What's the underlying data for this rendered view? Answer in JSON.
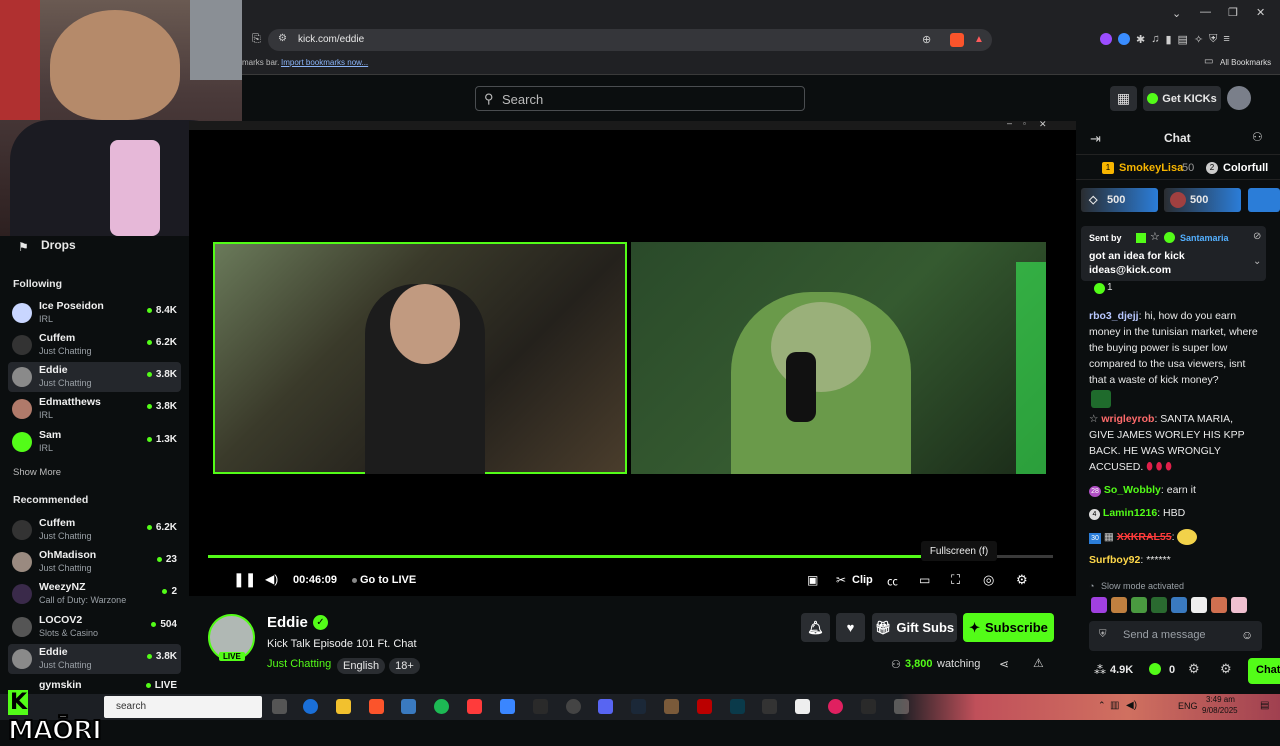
{
  "browser": {
    "url": "kick.com/eddie",
    "bookmarks_text": "marks bar.",
    "import_bookmarks": "Import bookmarks now...",
    "all_bookmarks": "All Bookmarks"
  },
  "header": {
    "search_placeholder": "Search",
    "get_kicks_label": "Get KICKs"
  },
  "sidebar": {
    "drops_label": "Drops",
    "following_heading": "Following",
    "following": [
      {
        "name": "Ice Poseidon",
        "category": "IRL",
        "viewers": "8.4K"
      },
      {
        "name": "Cuffem",
        "category": "Just Chatting",
        "viewers": "6.2K"
      },
      {
        "name": "Eddie",
        "category": "Just Chatting",
        "viewers": "3.8K"
      },
      {
        "name": "Edmatthews",
        "category": "IRL",
        "viewers": "3.8K"
      },
      {
        "name": "Sam",
        "category": "IRL",
        "viewers": "1.3K"
      }
    ],
    "show_more": "Show More",
    "recommended_heading": "Recommended",
    "recommended": [
      {
        "name": "Cuffem",
        "category": "Just Chatting",
        "viewers": "6.2K"
      },
      {
        "name": "OhMadison",
        "category": "Just Chatting",
        "viewers": "23"
      },
      {
        "name": "WeezyNZ",
        "category": "Call of Duty: Warzone",
        "viewers": "2"
      },
      {
        "name": "LOCOV2",
        "category": "Slots & Casino",
        "viewers": "504"
      },
      {
        "name": "Eddie",
        "category": "Just Chatting",
        "viewers": "3.8K"
      },
      {
        "name": "gymskin",
        "category": "",
        "viewers": "LIVE"
      }
    ]
  },
  "player": {
    "progress_fraction": 0.87,
    "time": "00:46:09",
    "go_live": "Go to LIVE",
    "clip_label": "Clip",
    "tooltip": "Fullscreen (f)"
  },
  "stream": {
    "channel_name": "Eddie",
    "title": "Kick Talk Episode 101 Ft. Chat",
    "category": "Just Chatting",
    "tags": [
      "English",
      "18+"
    ],
    "live_badge": "LIVE",
    "gift_subs_label": "Gift Subs",
    "subscribe_label": "Subscribe",
    "viewer_count": "3,800",
    "watching_label": "watching"
  },
  "chat": {
    "title": "Chat",
    "leaderboard": [
      {
        "rank": "1",
        "name": "SmokeyLisa",
        "points": "50"
      },
      {
        "rank": "2",
        "name": "Colorfull",
        "points": ""
      }
    ],
    "kicks_goals": [
      "500",
      "500"
    ],
    "pinned": {
      "sent_by": "Sent by",
      "sender": "Santamaria",
      "message": "got an idea for kick ideas@kick.com",
      "reactions": "1"
    },
    "messages": [
      {
        "user": "rbo3_djejj",
        "text": "hi, how do you earn money in the tunisian market, where the buying power is super low compared to the usa viewers, isnt that a waste of kick money?",
        "color": "#b8c7ff"
      },
      {
        "user": "wrigleyrob",
        "text": "SANTA MARIA, GIVE JAMES WORLEY HIS KPP BACK. HE WAS WRONGLY ACCUSED.",
        "color": "#ff6b6b"
      },
      {
        "user": "So_Wobbly",
        "text": "earn it",
        "color": "#53fc18"
      },
      {
        "user": "Lamin1216",
        "text": "HBD",
        "color": "#53fc18"
      },
      {
        "user": "XXKRAL55",
        "text": "",
        "color": "#ff3b3b"
      },
      {
        "user": "Surfboy92",
        "text": "******",
        "color": "#ffd84a"
      }
    ],
    "slow_mode": "Slow mode activated",
    "input_placeholder": "Send a message",
    "kicks_count": "4.9K",
    "points_count": "0",
    "chat_button": "Chat"
  },
  "taskbar": {
    "search_text": "search",
    "overlay_logo": "MAŌRI",
    "lang": "ENG",
    "time": "3:49 am",
    "date": "9/08/2025"
  }
}
